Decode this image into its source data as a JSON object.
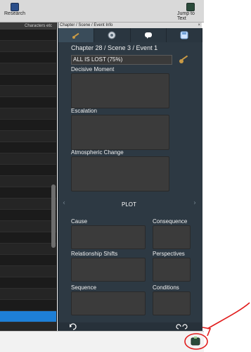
{
  "toolbar": {
    "research_label": "Research",
    "jump_label": "Jump to Text"
  },
  "left_panel": {
    "header": "Characters etc",
    "rows": 26,
    "selected_row": 26
  },
  "right_panel": {
    "header": "Chapter / Scene / Event Info",
    "close_icon": "×",
    "tabs": [
      {
        "icon": "key-icon"
      },
      {
        "icon": "pocketwatch-icon"
      },
      {
        "icon": "speech-bubble-icon"
      },
      {
        "icon": "save-icon"
      }
    ],
    "event_title": "Chapter 28 / Scene 3 / Event 1",
    "progress_text": "ALL IS LOST (75%)",
    "fields": {
      "decisive_moment": "Decisive Moment",
      "escalation": "Escalation",
      "atmospheric_change": "Atmospheric Change",
      "plot": "PLOT",
      "cause": "Cause",
      "consequence": "Consequence",
      "relationship_shifts": "Relationship Shifts",
      "perspectives": "Perspectives",
      "sequence": "Sequence",
      "conditions": "Conditions"
    }
  },
  "colors": {
    "accent_selected": "#1e7fd6",
    "annotation_red": "#e11b1b",
    "key_gold": "#c99a45",
    "panel_bg": "#2d3943"
  }
}
